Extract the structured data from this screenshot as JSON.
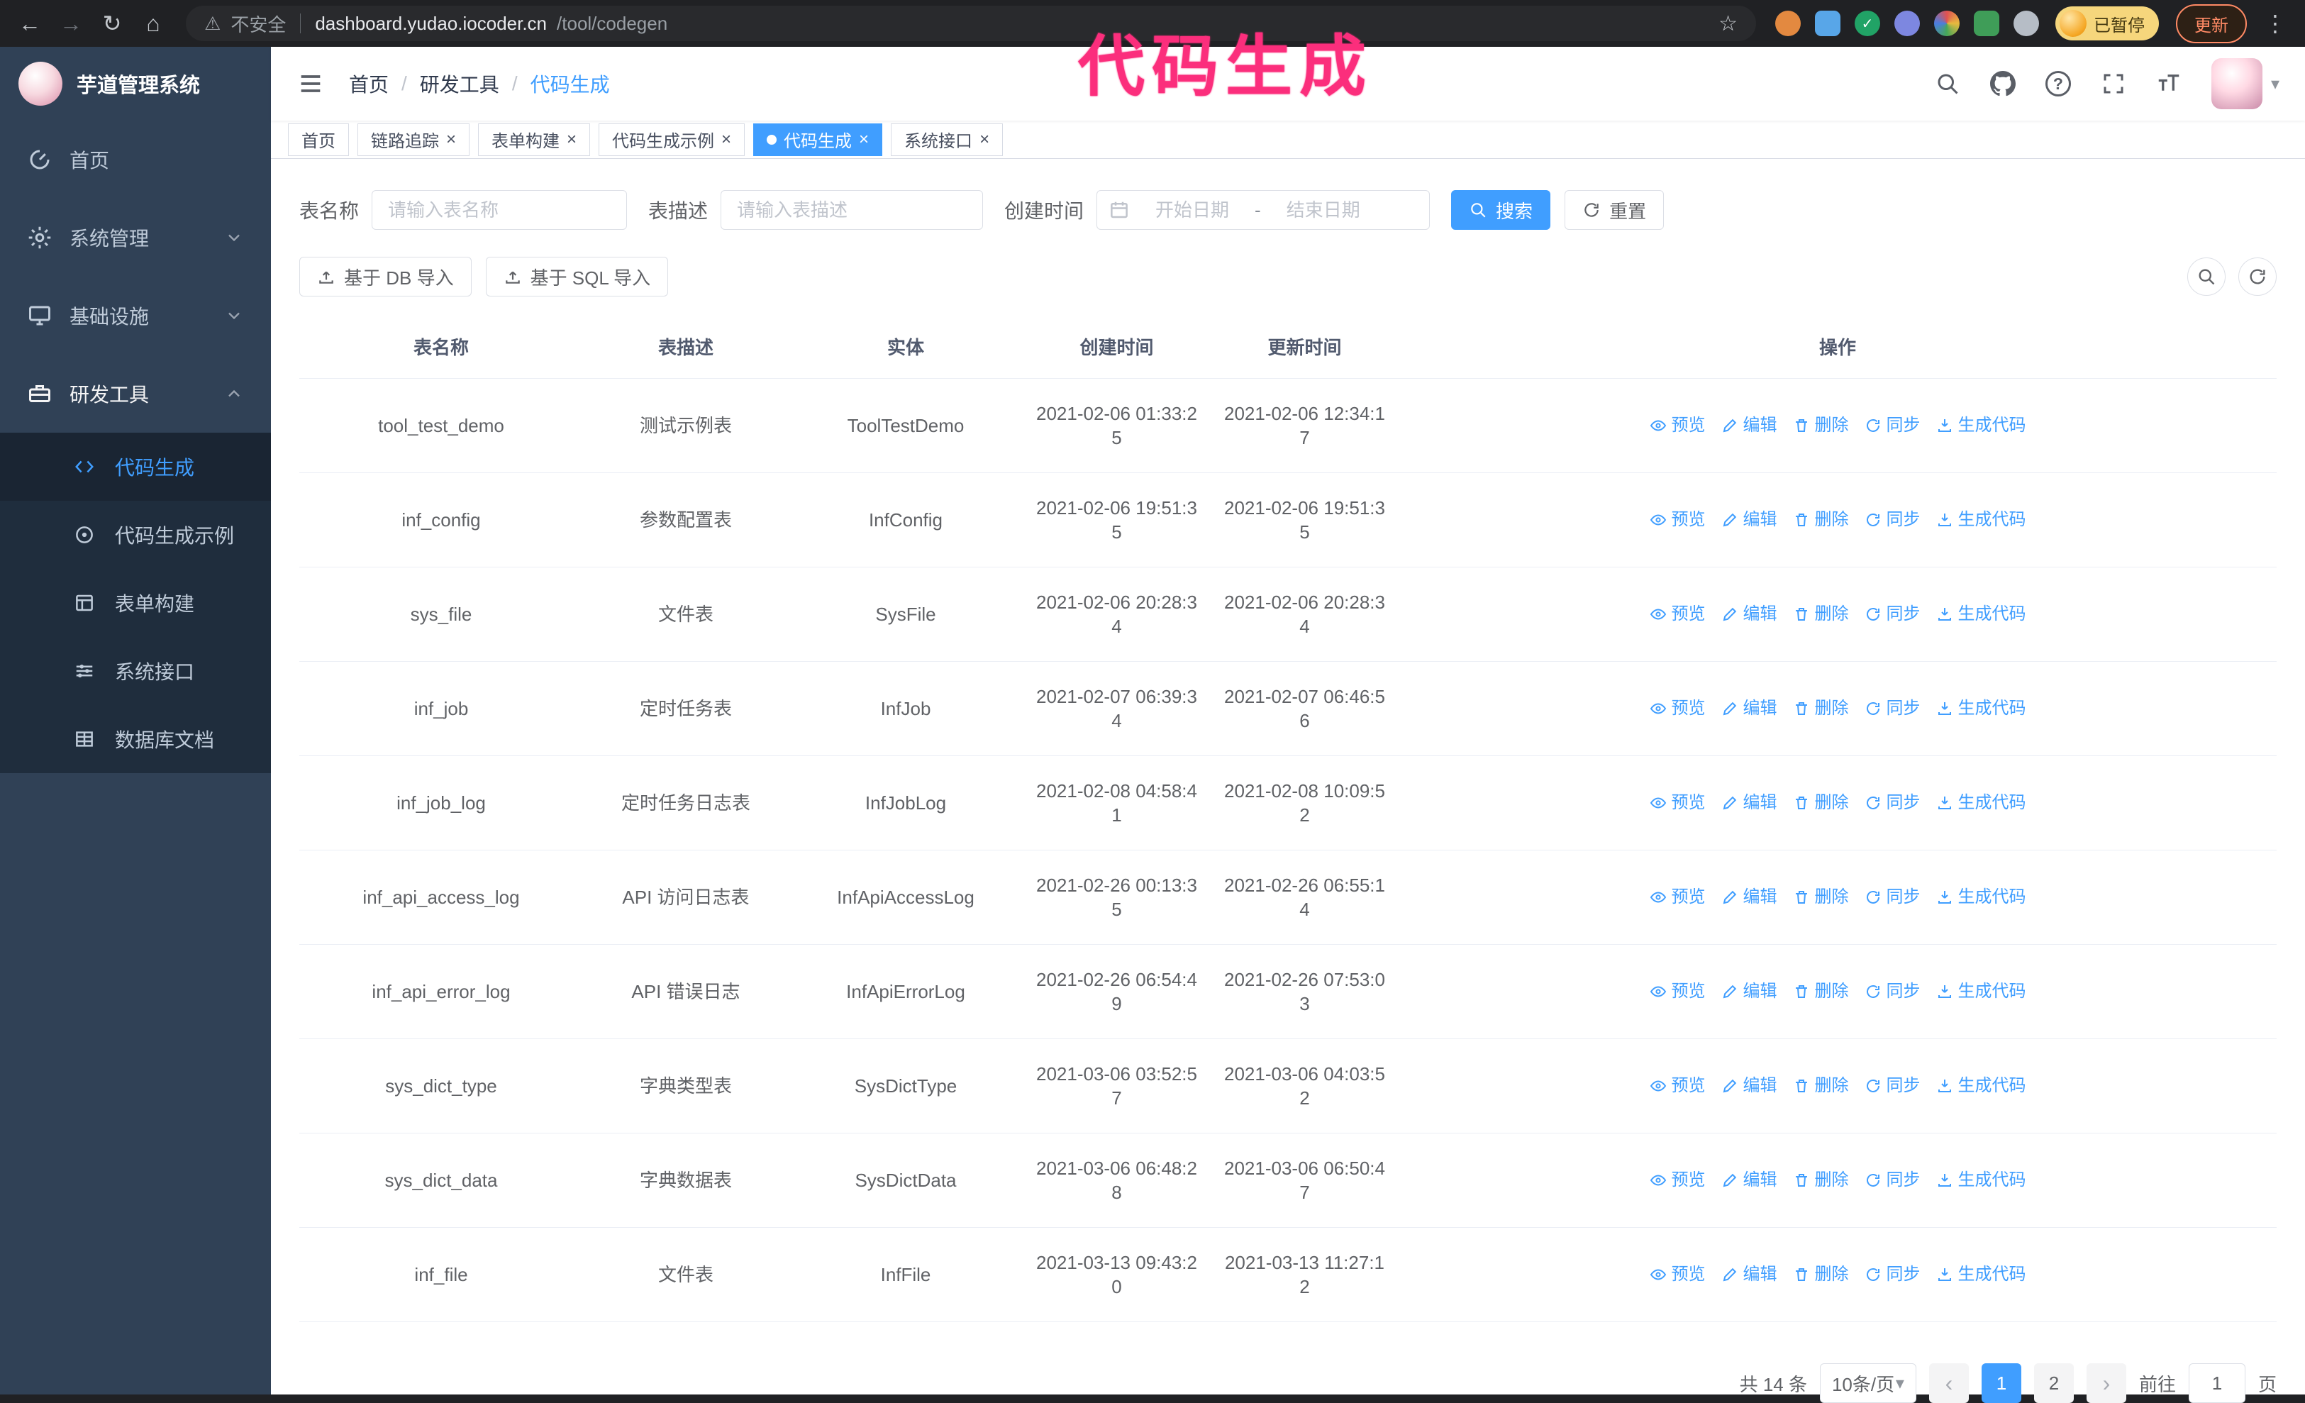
{
  "browser": {
    "security_warning": "不安全",
    "url_domain": "dashboard.yudao.iocoder.cn",
    "url_path": "/tool/codegen",
    "profile_badge": "已暂停",
    "update_label": "更新"
  },
  "annotation": {
    "text": "代码生成"
  },
  "icons": {
    "back": "←",
    "forward": "→",
    "reload": "↻",
    "home": "⌂",
    "warning": "⚠",
    "star": "☆",
    "kebab": "⋮",
    "check": "✓",
    "caret": "▾",
    "prev": "‹",
    "next": "›",
    "close": "×",
    "question": "?"
  },
  "sidebar": {
    "logo_title": "芋道管理系统",
    "menu": [
      {
        "label": "首页",
        "icon": "dashboard-icon"
      },
      {
        "label": "系统管理",
        "icon": "gear-icon"
      },
      {
        "label": "基础设施",
        "icon": "monitor-icon"
      },
      {
        "label": "研发工具",
        "icon": "toolbox-icon"
      }
    ],
    "submenu": [
      {
        "label": "代码生成",
        "icon": "code-icon",
        "active": true
      },
      {
        "label": "代码生成示例",
        "icon": "example-icon"
      },
      {
        "label": "表单构建",
        "icon": "form-icon"
      },
      {
        "label": "系统接口",
        "icon": "api-icon"
      },
      {
        "label": "数据库文档",
        "icon": "database-icon"
      }
    ]
  },
  "breadcrumb": {
    "items": [
      "首页",
      "研发工具",
      "代码生成"
    ]
  },
  "tabs": [
    {
      "label": "首页"
    },
    {
      "label": "链路追踪",
      "closable": true
    },
    {
      "label": "表单构建",
      "closable": true
    },
    {
      "label": "代码生成示例",
      "closable": true
    },
    {
      "label": "代码生成",
      "closable": true,
      "active": true
    },
    {
      "label": "系统接口",
      "closable": true
    }
  ],
  "filters": {
    "name_label": "表名称",
    "name_placeholder": "请输入表名称",
    "desc_label": "表描述",
    "desc_placeholder": "请输入表描述",
    "time_label": "创建时间",
    "start_placeholder": "开始日期",
    "range_separator": "-",
    "end_placeholder": "结束日期",
    "search_label": "搜索",
    "reset_label": "重置"
  },
  "toolbar": {
    "import_db_label": "基于 DB 导入",
    "import_sql_label": "基于 SQL 导入"
  },
  "table": {
    "columns": [
      "表名称",
      "表描述",
      "实体",
      "创建时间",
      "更新时间",
      "操作"
    ],
    "ops": [
      "预览",
      "编辑",
      "删除",
      "同步",
      "生成代码"
    ],
    "rows": [
      {
        "name": "tool_test_demo",
        "desc": "测试示例表",
        "entity": "ToolTestDemo",
        "created": "2021-02-06 01:33:25",
        "updated": "2021-02-06 12:34:17"
      },
      {
        "name": "inf_config",
        "desc": "参数配置表",
        "entity": "InfConfig",
        "created": "2021-02-06 19:51:35",
        "updated": "2021-02-06 19:51:35"
      },
      {
        "name": "sys_file",
        "desc": "文件表",
        "entity": "SysFile",
        "created": "2021-02-06 20:28:34",
        "updated": "2021-02-06 20:28:34"
      },
      {
        "name": "inf_job",
        "desc": "定时任务表",
        "entity": "InfJob",
        "created": "2021-02-07 06:39:34",
        "updated": "2021-02-07 06:46:56"
      },
      {
        "name": "inf_job_log",
        "desc": "定时任务日志表",
        "entity": "InfJobLog",
        "created": "2021-02-08 04:58:41",
        "updated": "2021-02-08 10:09:52"
      },
      {
        "name": "inf_api_access_log",
        "desc": "API 访问日志表",
        "entity": "InfApiAccessLog",
        "created": "2021-02-26 00:13:35",
        "updated": "2021-02-26 06:55:14"
      },
      {
        "name": "inf_api_error_log",
        "desc": "API 错误日志",
        "entity": "InfApiErrorLog",
        "created": "2021-02-26 06:54:49",
        "updated": "2021-02-26 07:53:03"
      },
      {
        "name": "sys_dict_type",
        "desc": "字典类型表",
        "entity": "SysDictType",
        "created": "2021-03-06 03:52:57",
        "updated": "2021-03-06 04:03:52"
      },
      {
        "name": "sys_dict_data",
        "desc": "字典数据表",
        "entity": "SysDictData",
        "created": "2021-03-06 06:48:28",
        "updated": "2021-03-06 06:50:47"
      },
      {
        "name": "inf_file",
        "desc": "文件表",
        "entity": "InfFile",
        "created": "2021-03-13 09:43:20",
        "updated": "2021-03-13 11:27:12"
      }
    ]
  },
  "pagination": {
    "total": "共 14 条",
    "page_size": "10条/页",
    "pages": [
      "1",
      "2"
    ],
    "active_page": "1",
    "goto_label": "前往",
    "goto_value": "1",
    "goto_suffix": "页"
  },
  "colors": {
    "accent": "#409eff",
    "annotation": "#fb2e7c",
    "sidebar_bg": "#304156",
    "submenu_bg": "#1f2d3d"
  }
}
